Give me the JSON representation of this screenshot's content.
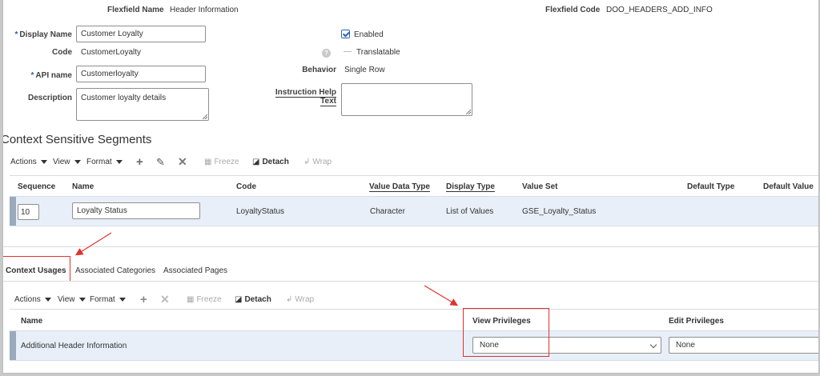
{
  "header": {
    "flexfield_name_label": "Flexfield Name",
    "flexfield_name_value": "Header Information",
    "flexfield_code_label": "Flexfield Code",
    "flexfield_code_value": "DOO_HEADERS_ADD_INFO"
  },
  "form": {
    "display_name_label": "Display Name",
    "display_name_value": "Customer Loyalty",
    "code_label": "Code",
    "code_value": "CustomerLoyalty",
    "api_name_label": "API name",
    "api_name_value": "Customerloyalty",
    "description_label": "Description",
    "description_value": "Customer loyalty details",
    "enabled_label": "Enabled",
    "translatable_label": "Translatable",
    "translatable_value": "—",
    "behavior_label": "Behavior",
    "behavior_value": "Single Row",
    "instruction_label": "Instruction Help Text",
    "instruction_value": "",
    "required_mark": "*",
    "help_glyph": "?"
  },
  "segments": {
    "title": "Context Sensitive Segments",
    "toolbar": {
      "actions": "Actions",
      "view": "View",
      "format": "Format",
      "freeze": "Freeze",
      "detach": "Detach",
      "wrap": "Wrap"
    },
    "columns": [
      "Sequence",
      "Name",
      "Code",
      "Value Data Type",
      "Display Type",
      "Value Set",
      "Default Type",
      "Default Value"
    ],
    "rows": [
      {
        "sequence": "10",
        "name": "Loyalty Status",
        "code": "LoyaltyStatus",
        "value_data_type": "Character",
        "display_type": "List of Values",
        "value_set": "GSE_Loyalty_Status",
        "default_type": "",
        "default_value": ""
      }
    ]
  },
  "tabs": [
    "Context Usages",
    "Associated Categories",
    "Associated Pages"
  ],
  "usages": {
    "toolbar": {
      "actions": "Actions",
      "view": "View",
      "format": "Format",
      "freeze": "Freeze",
      "detach": "Detach",
      "wrap": "Wrap"
    },
    "columns": [
      "Name",
      "View Privileges",
      "Edit Privileges"
    ],
    "rows": [
      {
        "name": "Additional Header Information",
        "view_privileges": "None",
        "edit_privileges": "None"
      }
    ]
  },
  "colors": {
    "accent": "#2b63b6",
    "annotation": "#e0322d",
    "selected_row": "#e8eff8"
  }
}
